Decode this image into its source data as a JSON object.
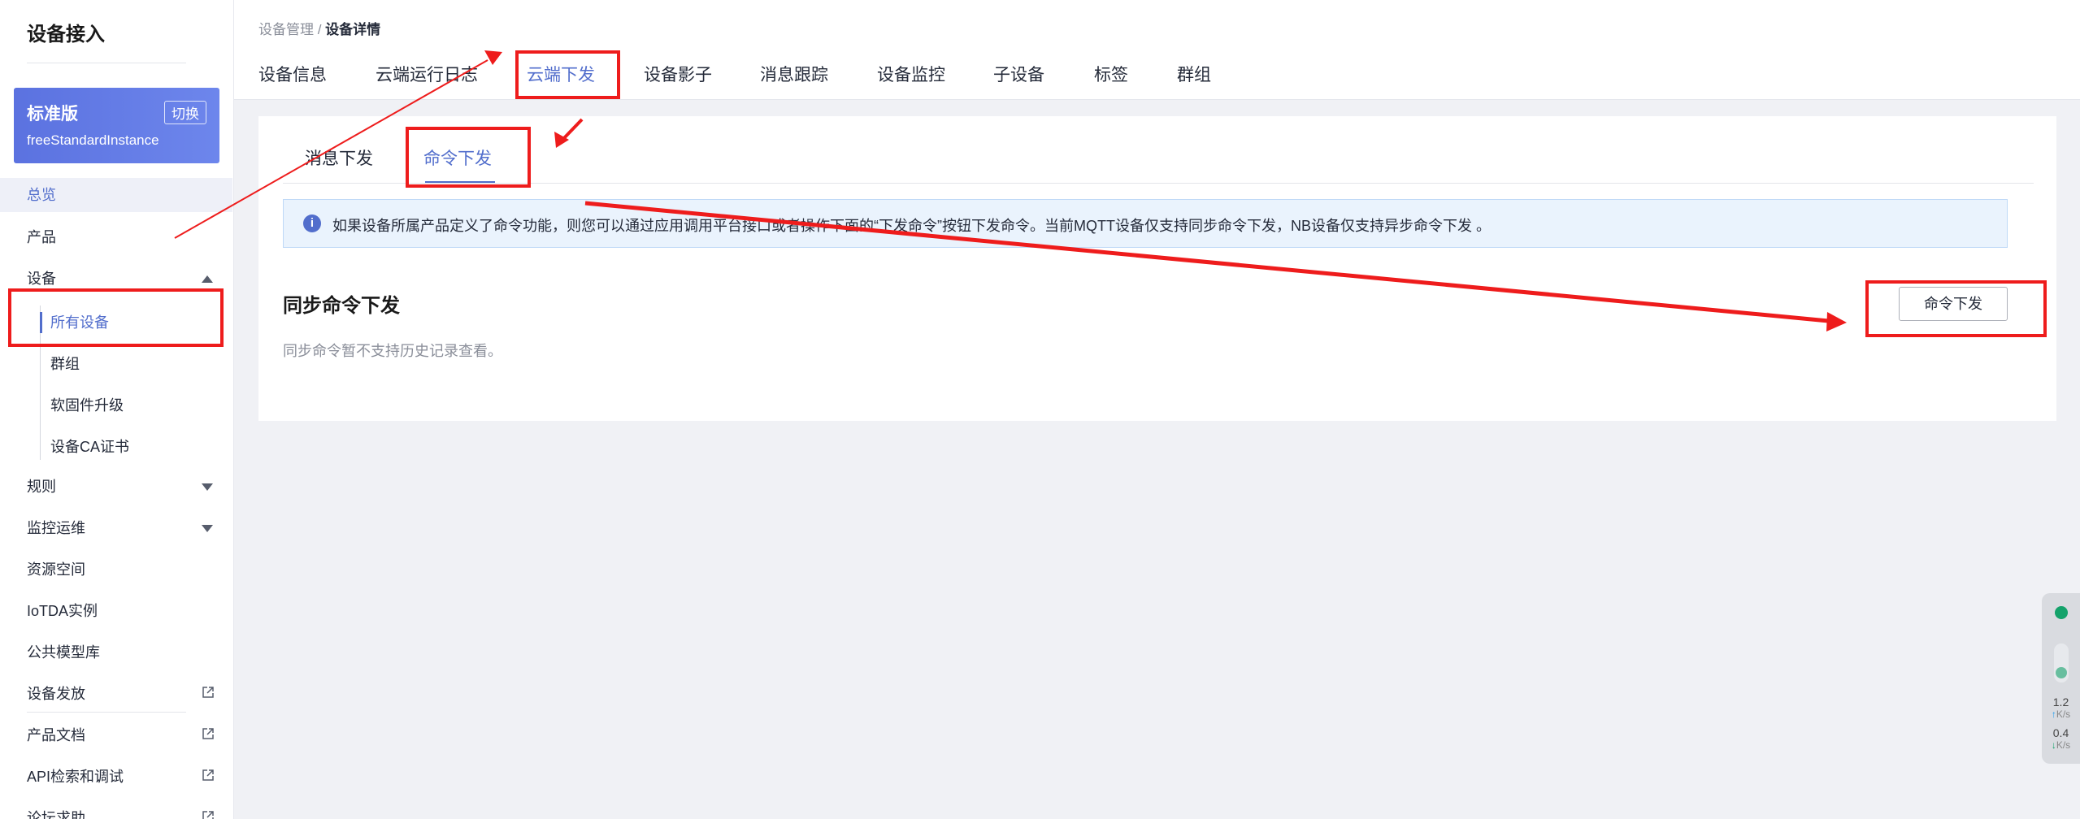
{
  "sidebar": {
    "title": "设备接入",
    "edition": {
      "name": "标准版",
      "switch_label": "切换",
      "instance": "freeStandardInstance"
    },
    "items": {
      "overview": "总览",
      "product": "产品",
      "device": "设备",
      "all_devices": "所有设备",
      "group": "群组",
      "ota": "软固件升级",
      "ca_cert": "设备CA证书",
      "rules": "规则",
      "monitor_ops": "监控运维",
      "resource_space": "资源空间",
      "iotda_instance": "IoTDA实例",
      "public_model_lib": "公共模型库",
      "device_provisioning": "设备发放",
      "product_docs": "产品文档",
      "api_explorer": "API检索和调试",
      "forum_help": "论坛求助"
    }
  },
  "breadcrumb": {
    "parent": "设备管理",
    "separator": " / ",
    "current": "设备详情"
  },
  "tabs": [
    "设备信息",
    "云端运行日志",
    "云端下发",
    "设备影子",
    "消息跟踪",
    "设备监控",
    "子设备",
    "标签",
    "群组"
  ],
  "subtabs": [
    "消息下发",
    "命令下发"
  ],
  "info": {
    "text": "如果设备所属产品定义了命令功能，则您可以通过应用调用平台接口或者操作下面的“下发命令”按钮下发命令。当前MQTT设备仅支持同步命令下发，NB设备仅支持异步命令下发 。"
  },
  "section": {
    "title": "同步命令下发",
    "desc": "同步命令暂不支持历史记录查看。",
    "button": "命令下发"
  },
  "net_widget": {
    "up": "1.2",
    "up_unit": "K/s",
    "down": "0.4",
    "down_unit": "K/s"
  },
  "colors": {
    "accent": "#526ecc",
    "annotation": "#ee1c1c",
    "info_bg": "#eaf3fd"
  }
}
